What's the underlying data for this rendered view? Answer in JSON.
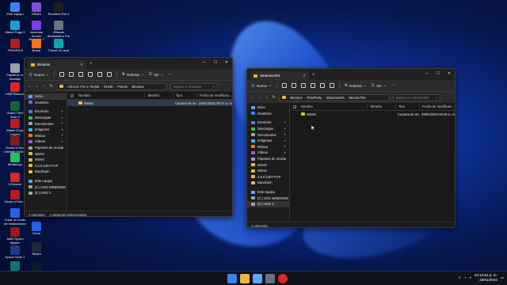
{
  "desktop_icons": [
    {
      "label": "Este equipo",
      "color": "#3b82f6",
      "icon": "computer-icon"
    },
    {
      "label": "KBalm",
      "color": "#7a4fd1",
      "icon": "app-icon"
    },
    {
      "label": "Resident Evil 4",
      "color": "#1f1f1f",
      "icon": "game-icon"
    },
    {
      "label": "Watch Dogs 2",
      "color": "#1a9fd3",
      "icon": "game-icon"
    },
    {
      "label": "Icecream Screen Recorder 7",
      "color": "#7c3aed",
      "icon": "recorder-icon"
    },
    {
      "label": "VMware Workstation Pro",
      "color": "#6b7280",
      "icon": "vm-icon"
    },
    {
      "label": "TEKKEN 8",
      "color": "#b91c1c",
      "icon": "game-icon"
    },
    {
      "label": "Brave",
      "color": "#f97316",
      "icon": "browser-icon"
    },
    {
      "label": "Planet of Lana",
      "color": "#0ea5a4",
      "icon": "game-icon"
    },
    {
      "label": "Papelera de reciclaje",
      "color": "#9ca3af",
      "icon": "trash-icon"
    },
    {
      "label": "USB Rescate",
      "color": "#dc2626",
      "icon": "usb-icon"
    },
    {
      "label": "Grand Theft Auto V",
      "color": "#166534",
      "icon": "game-icon"
    },
    {
      "label": "Watch Dogs Legion",
      "color": "#b91c1c",
      "icon": "game-icon"
    },
    {
      "label": "Gears of War Ultimate Edition",
      "color": "#7f1d1d",
      "icon": "game-icon"
    },
    {
      "label": "WhatsApp",
      "color": "#22c55e",
      "icon": "whatsapp-icon"
    },
    {
      "label": "CCleaner",
      "color": "#dc2626",
      "icon": "ccleaner-icon"
    },
    {
      "label": "Gears of War 5",
      "color": "#b91c1c",
      "icon": "game-icon"
    },
    {
      "label": "Crear un punto de restauración",
      "color": "#2563eb",
      "icon": "restore-icon"
    },
    {
      "label": "AMD Ryzen Master",
      "color": "#991b1b",
      "icon": "amd-icon"
    },
    {
      "label": "Zoom",
      "color": "#2563eb",
      "icon": "zoom-icon"
    },
    {
      "label": "Epson Scan 2",
      "color": "#1e3a8a",
      "icon": "scanner-icon"
    },
    {
      "label": "Steam",
      "color": "#1e293b",
      "icon": "steam-icon"
    },
    {
      "label": "Ectree + info",
      "color": "#0f766e",
      "icon": "app-icon"
    },
    {
      "label": "The Callisto Protocol",
      "color": "#111827",
      "icon": "game-icon"
    }
  ],
  "win1": {
    "tab_title": "Binarios",
    "toolbar": {
      "new": "Nuevo",
      "sort": "Ordenar",
      "view": "Ver"
    },
    "address": [
      "CRACK FIX V. RUNE",
      "RUNE",
      "Polaris",
      "Binarios"
    ],
    "search_placeholder": "Buscar en Binarios",
    "nav": [
      {
        "label": "Inicio",
        "color": "#60a5fa",
        "pin": false,
        "sel": true
      },
      {
        "label": "OneDrive",
        "color": "#3b82f6",
        "pin": false
      },
      {
        "gap": true
      },
      {
        "label": "Escritorio",
        "color": "#3b82f6",
        "pin": true
      },
      {
        "label": "Descargas",
        "color": "#22c55e",
        "pin": true
      },
      {
        "label": "Documentos",
        "color": "#9ca3af",
        "pin": true
      },
      {
        "label": "Imágenes",
        "color": "#38bdf8",
        "pin": true
      },
      {
        "label": "Música",
        "color": "#f97316",
        "pin": true
      },
      {
        "label": "Vídeos",
        "color": "#a855f7",
        "pin": true
      },
      {
        "label": "Papelera de recicla",
        "color": "#9ca3af",
        "pin": true
      },
      {
        "label": "Win64",
        "color": "#e8b93a",
        "pin": false
      },
      {
        "label": "Win64",
        "color": "#e8b93a",
        "pin": false
      },
      {
        "label": "4.5.0.1307-PVP",
        "color": "#e8b93a",
        "pin": false
      },
      {
        "label": "Bandicam",
        "color": "#e8b93a",
        "pin": false
      },
      {
        "gap": true
      },
      {
        "label": "Este equipo",
        "color": "#60a5fa",
        "pin": false
      },
      {
        "label": "(C:) SSD WINDOWS",
        "color": "#9ca3af",
        "pin": false
      },
      {
        "label": "(D:) HDD 1",
        "color": "#9ca3af",
        "pin": false
      }
    ],
    "columns": [
      "Nombre",
      "Tamaño",
      "Tipo",
      "Fecha de modificaci..."
    ],
    "files": [
      {
        "name": "Win64",
        "size": "",
        "type": "Carpeta de arc...",
        "date": "29/01/2024 06:27 a. m."
      }
    ],
    "status": {
      "count": "1 elemento",
      "selected": "1 elemento seleccionado"
    }
  },
  "win2": {
    "tab_title": "SteamworkS",
    "toolbar": {
      "new": "Nuevo",
      "sort": "Ordenar",
      "view": "Ver"
    },
    "address": [
      "Binarios",
      "ThirdParty",
      "Steamworks",
      "SteamvT53"
    ],
    "search_placeholder": "Buscar en SteamvT53",
    "nav": [
      {
        "label": "Inicio",
        "color": "#60a5fa",
        "pin": false
      },
      {
        "label": "OneDrive",
        "color": "#3b82f6",
        "pin": false
      },
      {
        "gap": true
      },
      {
        "label": "Escritorio",
        "color": "#3b82f6",
        "pin": true
      },
      {
        "label": "Descargas",
        "color": "#22c55e",
        "pin": true
      },
      {
        "label": "Documentos",
        "color": "#9ca3af",
        "pin": true
      },
      {
        "label": "Imágenes",
        "color": "#38bdf8",
        "pin": true
      },
      {
        "label": "Música",
        "color": "#f97316",
        "pin": true
      },
      {
        "label": "Vídeos",
        "color": "#a855f7",
        "pin": true
      },
      {
        "label": "Papelera de recicla",
        "color": "#9ca3af",
        "pin": true
      },
      {
        "label": "Win64",
        "color": "#e8b93a",
        "pin": false
      },
      {
        "label": "Win64",
        "color": "#e8b93a",
        "pin": false
      },
      {
        "label": "4.5.0.1307-PVP",
        "color": "#e8b93a",
        "pin": false
      },
      {
        "label": "Bandicam",
        "color": "#e8b93a",
        "pin": false
      },
      {
        "gap": true
      },
      {
        "label": "Este equipo",
        "color": "#60a5fa",
        "pin": false
      },
      {
        "label": "(C:) SSD WINDOWS",
        "color": "#9ca3af",
        "pin": false
      },
      {
        "label": "(D:) HDD 1",
        "color": "#9ca3af",
        "pin": false,
        "sel": true
      }
    ],
    "columns": [
      "Nombre",
      "Tamaño",
      "Tipo",
      "Fecha de modificaci..."
    ],
    "files": [
      {
        "name": "Win64",
        "size": "",
        "type": "Carpeta de arc...",
        "date": "29/01/2024 06:28 a. m."
      }
    ],
    "status": {
      "count": "1 elemento",
      "selected": ""
    }
  },
  "taskbar": {
    "apps": [
      {
        "name": "start-icon",
        "color": "#3b82f6"
      },
      {
        "name": "file-explorer-icon",
        "color": "#e8b93a"
      },
      {
        "name": "photos-icon",
        "color": "#60a5fa"
      },
      {
        "name": "media-icon",
        "color": "#6b7280"
      },
      {
        "name": "record-icon",
        "color": "#dc2626"
      }
    ],
    "time": "04:12:52 p. m.",
    "date": "29/01/2024"
  }
}
